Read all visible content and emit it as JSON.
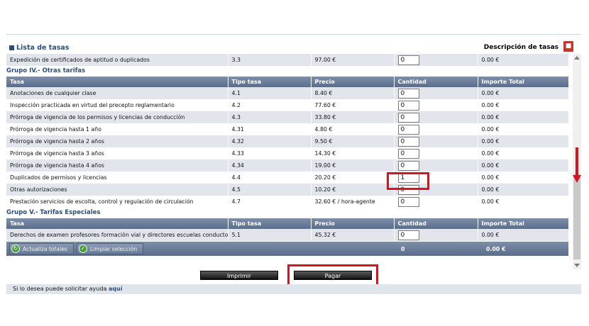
{
  "header": {
    "list_title": "Lista de tasas",
    "desc_link": "Descripción de tasas",
    "pdf_icon": "pdf-icon"
  },
  "first_row": {
    "tasa": "Expedición de certificados de aptitud o duplicados",
    "tipo": "3.3",
    "precio": "97.00 €",
    "cantidad": "0",
    "importe": "0.00 €"
  },
  "group4": {
    "title": "Grupo IV.- Otras tarifas",
    "headers": [
      "Tasa",
      "Tipo tasa",
      "Precio",
      "Cantidad",
      "Importe Total"
    ],
    "rows": [
      {
        "tasa": "Anotaciones de cualquier clase",
        "tipo": "4.1",
        "precio": "8.40 €",
        "cantidad": "0",
        "importe": "0.00 €"
      },
      {
        "tasa": "Inspección practicada en virtud del precepto reglamentario",
        "tipo": "4.2",
        "precio": "77.60 €",
        "cantidad": "0",
        "importe": "0.00 €"
      },
      {
        "tasa": "Prórroga de vigencia de los permisos y licencias de conducción",
        "tipo": "4.3",
        "precio": "33.80 €",
        "cantidad": "0",
        "importe": "0.00 €"
      },
      {
        "tasa": "Prórroga de vigencia hasta 1 año",
        "tipo": "4.31",
        "precio": "4.80 €",
        "cantidad": "0",
        "importe": "0.00 €"
      },
      {
        "tasa": "Prórroga de vigencia hasta 2 años",
        "tipo": "4.32",
        "precio": "9.50 €",
        "cantidad": "0",
        "importe": "0.00 €"
      },
      {
        "tasa": "Prórroga de vigencia hasta 3 años",
        "tipo": "4.33",
        "precio": "14.30 €",
        "cantidad": "0",
        "importe": "0.00 €"
      },
      {
        "tasa": "Prórroga de vigencia hasta 4 años",
        "tipo": "4.34",
        "precio": "19.00 €",
        "cantidad": "0",
        "importe": "0.00 €"
      },
      {
        "tasa": "Duplicados de permisos y licencias",
        "tipo": "4.4",
        "precio": "20.20 €",
        "cantidad": "1",
        "importe": "0.00 €"
      },
      {
        "tasa": "Otras autorizaciones",
        "tipo": "4.5",
        "precio": "10.20 €",
        "cantidad": "0",
        "importe": "0.00 €"
      },
      {
        "tasa": "Prestación servicios de escolta, control y regulación de circulación",
        "tipo": "4.7",
        "precio": "32.60 € / hora-agente",
        "cantidad": "0",
        "importe": "0.00 €"
      }
    ]
  },
  "group5": {
    "title": "Grupo V.- Tarifas Especiales",
    "headers": [
      "Tasa",
      "Tipo tasa",
      "Precio",
      "Cantidad",
      "Importe Total"
    ],
    "rows": [
      {
        "tasa": "Derechos de examen profesores formación vial y directores escuelas conductores.",
        "tipo": "5.1",
        "precio": "45.32 €",
        "cantidad": "0",
        "importe": "0.00 €"
      }
    ]
  },
  "totals": {
    "update_label": "Actualiza totales",
    "clear_label": "Limpiar selección",
    "qty_total": "0",
    "amount_total": "0.00 €"
  },
  "actions": {
    "print_label": "Imprimir",
    "pay_label": "Pagar"
  },
  "footer": {
    "text": "Si lo desea puede solicitar ayuda",
    "link": "aquí"
  },
  "colors": {
    "highlight": "#d4141e",
    "header_bg": "#6b7d9a",
    "title": "#2c4e7a"
  }
}
